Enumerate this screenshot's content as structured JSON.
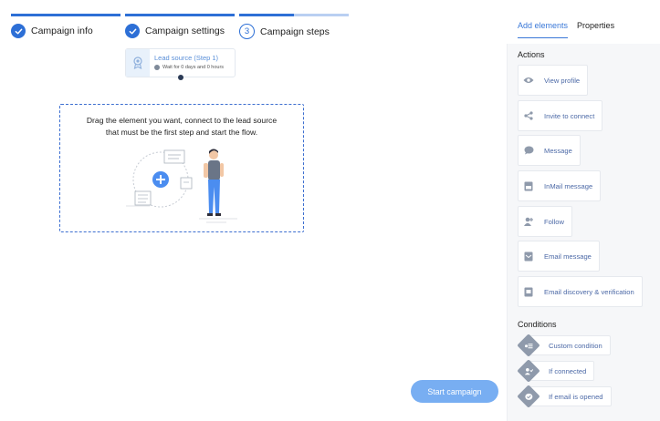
{
  "stepper": {
    "steps": [
      {
        "label": "Campaign info",
        "state": "done"
      },
      {
        "label": "Campaign settings",
        "state": "done"
      },
      {
        "label": "Campaign steps",
        "state": "current",
        "number": "3"
      }
    ],
    "accent": "#2d6fd6"
  },
  "canvas": {
    "lead_source": {
      "title": "Lead source (Step 1)",
      "subtitle": "Wait for 0 days and 0 hours",
      "icon": "badge-icon"
    },
    "dropzone": {
      "message_line1": "Drag the element you want, connect to the lead source",
      "message_line2": "that must be the first step and start the flow."
    },
    "start_button": "Start campaign"
  },
  "sidebar": {
    "tabs": [
      {
        "label": "Add elements",
        "active": true
      },
      {
        "label": "Properties",
        "active": false
      }
    ],
    "actions_title": "Actions",
    "actions": [
      {
        "label": "View profile",
        "icon": "eye-icon"
      },
      {
        "label": "Invite to connect",
        "icon": "share-icon"
      },
      {
        "label": "Message",
        "icon": "chat-bubble-icon"
      },
      {
        "label": "InMail message",
        "icon": "inmail-icon"
      },
      {
        "label": "Follow",
        "icon": "follow-icon"
      },
      {
        "label": "Email message",
        "icon": "email-icon"
      },
      {
        "label": "Email discovery & verification",
        "icon": "email-verify-icon"
      }
    ],
    "conditions_title": "Conditions",
    "conditions": [
      {
        "label": "Custom condition",
        "icon": "custom-condition-icon"
      },
      {
        "label": "If connected",
        "icon": "connected-icon"
      },
      {
        "label": "If email is opened",
        "icon": "email-opened-icon"
      }
    ]
  }
}
